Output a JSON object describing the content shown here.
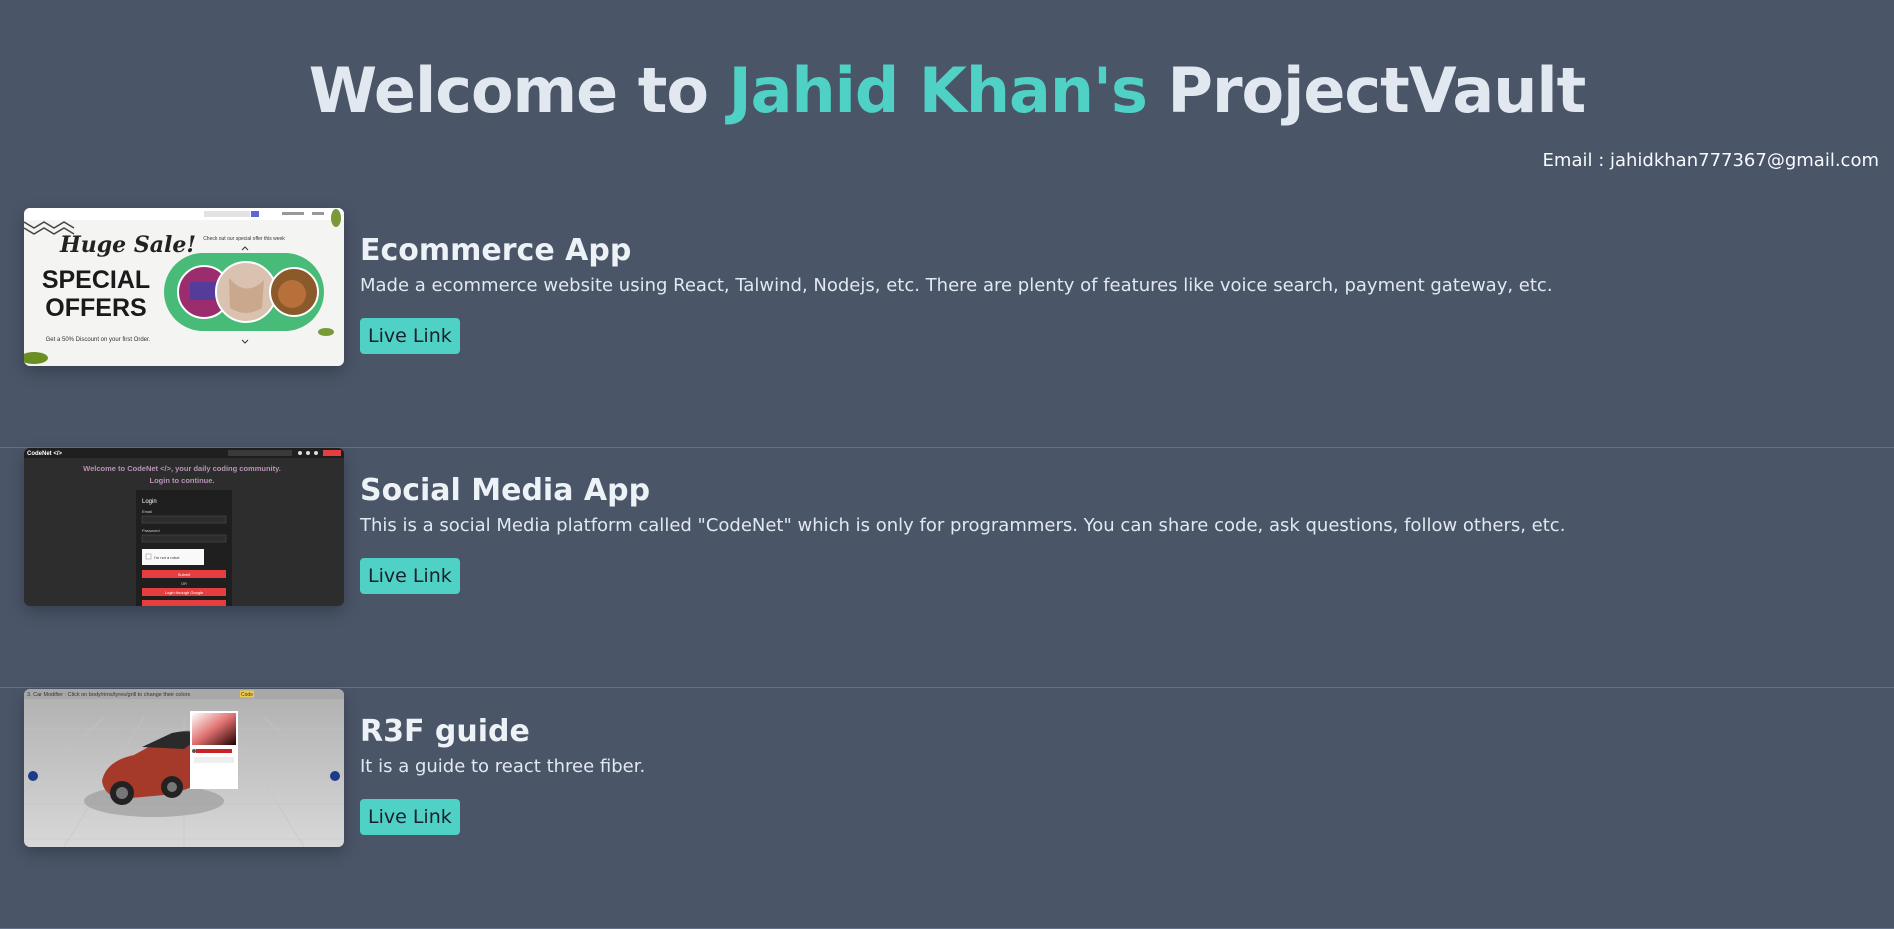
{
  "header": {
    "prefix": "Welcome to ",
    "name": "Jahid Khan's",
    "suffix": " ProjectVault"
  },
  "contact": {
    "email": "Email : jahidkhan777367@gmail.com"
  },
  "projects": [
    {
      "title": "Ecommerce App",
      "description": "Made a ecommerce website using React, Talwind, Nodejs, etc. There are plenty of features like voice search, payment gateway, etc.",
      "link_label": "Live Link",
      "thumbnail": {
        "banner_script": "Huge Sale!",
        "banner_line1": "SPECIAL",
        "banner_line2": "OFFERS",
        "banner_sub": "Get a 50% Discount on your first Order.",
        "offer_caption": "Check out our special offer this week"
      }
    },
    {
      "title": "Social Media App",
      "description": "This is a social Media platform called \"CodeNet\" which is only for programmers. You can share code, ask questions, follow others, etc.",
      "link_label": "Live Link",
      "thumbnail": {
        "brand": "CodeNet </>",
        "welcome": "Welcome to CodeNet </>, your daily coding community.",
        "login_prompt": "Login to continue.",
        "form_title": "Login",
        "email_label": "Email",
        "password_label": "Password",
        "captcha": "I'm not a robot",
        "submit": "Submit",
        "or": "OR",
        "google": "Login through Google"
      }
    },
    {
      "title": "R3F guide",
      "description": "It is a guide to react three fiber.",
      "link_label": "Live Link",
      "thumbnail": {
        "caption": "3. Car Modifier : Click on body/rims/tyres/grill to change their colors",
        "code_tag": "Code"
      }
    }
  ],
  "colors": {
    "background": "#4a5568",
    "accent": "#4fd1c5",
    "text": "#e2e8f0"
  }
}
